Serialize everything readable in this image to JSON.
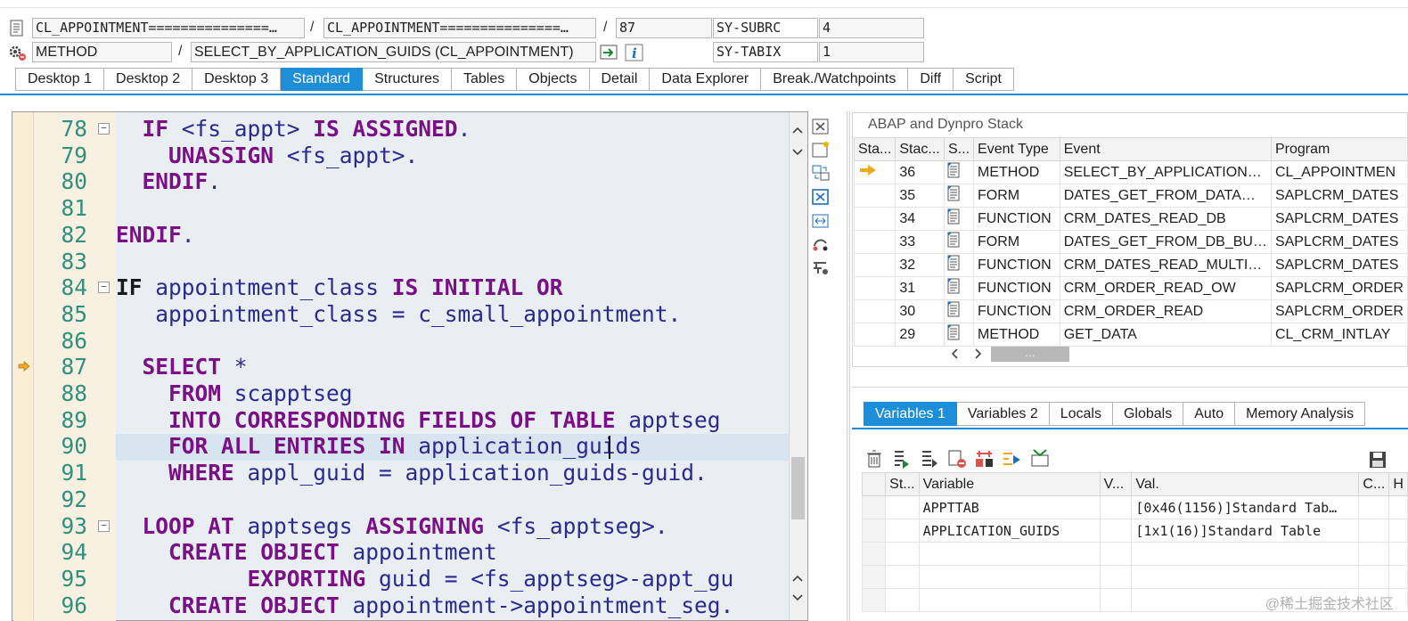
{
  "header": {
    "row1": {
      "program": "CL_APPOINTMENT===============…",
      "include": "CL_APPOINTMENT===============…",
      "line": "87",
      "sy_label": "SY-SUBRC",
      "sy_value": "4"
    },
    "row2": {
      "event_type": "METHOD",
      "event": "SELECT_BY_APPLICATION_GUIDS (CL_APPOINTMENT)",
      "sy_label": "SY-TABIX",
      "sy_value": "1"
    },
    "separator": "/"
  },
  "tabs": [
    "Desktop 1",
    "Desktop 2",
    "Desktop 3",
    "Standard",
    "Structures",
    "Tables",
    "Objects",
    "Detail",
    "Data Explorer",
    "Break./Watchpoints",
    "Diff",
    "Script"
  ],
  "active_tab": "Standard",
  "editor": {
    "lines": [
      {
        "n": "78",
        "fold": true,
        "indent": "  ",
        "tokens": [
          [
            "kw",
            "IF "
          ],
          [
            "t",
            "<fs_appt> "
          ],
          [
            "kw",
            "IS ASSIGNED"
          ],
          [
            "t",
            "."
          ]
        ]
      },
      {
        "n": "79",
        "fold": false,
        "indent": "    ",
        "tokens": [
          [
            "kw",
            "UNASSIGN "
          ],
          [
            "t",
            "<fs_appt>."
          ]
        ]
      },
      {
        "n": "80",
        "fold": false,
        "indent": "  ",
        "tokens": [
          [
            "kw",
            "ENDIF"
          ],
          [
            "t",
            "."
          ]
        ]
      },
      {
        "n": "81",
        "fold": false,
        "indent": "",
        "tokens": []
      },
      {
        "n": "82",
        "fold": false,
        "indent": "",
        "tokens": [
          [
            "kw",
            "ENDIF"
          ],
          [
            "t",
            "."
          ]
        ]
      },
      {
        "n": "83",
        "fold": false,
        "indent": "",
        "tokens": []
      },
      {
        "n": "84",
        "fold": true,
        "indent": "",
        "tokens": [
          [
            "kwb",
            "IF "
          ],
          [
            "t",
            "appointment_class "
          ],
          [
            "kw",
            "IS INITIAL OR"
          ]
        ]
      },
      {
        "n": "85",
        "fold": false,
        "indent": "   ",
        "tokens": [
          [
            "t",
            "appointment_class = c_small_appointment."
          ]
        ]
      },
      {
        "n": "86",
        "fold": false,
        "indent": "",
        "tokens": []
      },
      {
        "n": "87",
        "fold": false,
        "indent": "  ",
        "tokens": [
          [
            "kw",
            "SELECT "
          ],
          [
            "t",
            "*"
          ]
        ]
      },
      {
        "n": "88",
        "fold": false,
        "indent": "    ",
        "tokens": [
          [
            "kw",
            "FROM "
          ],
          [
            "t",
            "scapptseg"
          ]
        ]
      },
      {
        "n": "89",
        "fold": false,
        "indent": "    ",
        "tokens": [
          [
            "kw",
            "INTO CORRESPONDING FIELDS OF TABLE "
          ],
          [
            "t",
            "apptseg"
          ]
        ]
      },
      {
        "n": "90",
        "fold": false,
        "indent": "    ",
        "tokens": [
          [
            "kw",
            "FOR ALL ENTRIES IN "
          ],
          [
            "t",
            "application_guids"
          ]
        ]
      },
      {
        "n": "91",
        "fold": false,
        "indent": "    ",
        "tokens": [
          [
            "kw",
            "WHERE "
          ],
          [
            "t",
            "appl_guid = application_guids-guid."
          ]
        ]
      },
      {
        "n": "92",
        "fold": false,
        "indent": "",
        "tokens": []
      },
      {
        "n": "93",
        "fold": true,
        "indent": "  ",
        "tokens": [
          [
            "kw",
            "LOOP AT "
          ],
          [
            "t",
            "apptsegs "
          ],
          [
            "kw",
            "ASSIGNING "
          ],
          [
            "t",
            "<fs_apptseg>."
          ]
        ]
      },
      {
        "n": "94",
        "fold": false,
        "indent": "    ",
        "tokens": [
          [
            "kw",
            "CREATE OBJECT "
          ],
          [
            "t",
            "appointment"
          ]
        ]
      },
      {
        "n": "95",
        "fold": false,
        "indent": "          ",
        "tokens": [
          [
            "kw",
            "EXPORTING "
          ],
          [
            "t",
            "guid = <fs_apptseg>-appt_gu"
          ]
        ]
      },
      {
        "n": "96",
        "fold": false,
        "indent": "    ",
        "tokens": [
          [
            "kw",
            "CREATE OBJECT "
          ],
          [
            "t",
            "appointment->appointment_seg."
          ]
        ]
      }
    ],
    "current_line": "87",
    "highlight_line": "90"
  },
  "stack": {
    "title": "ABAP and Dynpro Stack",
    "columns": [
      "Sta...",
      "Stac...",
      "S...",
      "Event Type",
      "Event",
      "Program"
    ],
    "rows": [
      {
        "current": true,
        "depth": "36",
        "type": "METHOD",
        "event": "SELECT_BY_APPLICATION…",
        "program": "CL_APPOINTMEN"
      },
      {
        "current": false,
        "depth": "35",
        "type": "FORM",
        "event": "DATES_GET_FROM_DATA…",
        "program": "SAPLCRM_DATES"
      },
      {
        "current": false,
        "depth": "34",
        "type": "FUNCTION",
        "event": "CRM_DATES_READ_DB",
        "program": "SAPLCRM_DATES"
      },
      {
        "current": false,
        "depth": "33",
        "type": "FORM",
        "event": "DATES_GET_FROM_DB_BU…",
        "program": "SAPLCRM_DATES"
      },
      {
        "current": false,
        "depth": "32",
        "type": "FUNCTION",
        "event": "CRM_DATES_READ_MULTI…",
        "program": "SAPLCRM_DATES"
      },
      {
        "current": false,
        "depth": "31",
        "type": "FUNCTION",
        "event": "CRM_ORDER_READ_OW",
        "program": "SAPLCRM_ORDER"
      },
      {
        "current": false,
        "depth": "30",
        "type": "FUNCTION",
        "event": "CRM_ORDER_READ",
        "program": "SAPLCRM_ORDER"
      },
      {
        "current": false,
        "depth": "29",
        "type": "METHOD",
        "event": "GET_DATA",
        "program": "CL_CRM_INTLAY"
      }
    ]
  },
  "variables": {
    "tabs": [
      "Variables 1",
      "Variables 2",
      "Locals",
      "Globals",
      "Auto",
      "Memory Analysis"
    ],
    "active_tab": "Variables 1",
    "columns": [
      "St...",
      "Variable",
      "V...",
      "Val.",
      "C...",
      "H"
    ],
    "rows": [
      {
        "variable": "APPTTAB",
        "value": "[0x46(1156)]Standard Tab…"
      },
      {
        "variable": "APPLICATION_GUIDS",
        "value": "[1x1(16)]Standard Table"
      },
      {
        "variable": "",
        "value": ""
      },
      {
        "variable": "",
        "value": ""
      },
      {
        "variable": "",
        "value": ""
      }
    ]
  },
  "scroll_thumb": "…",
  "watermark": "@稀土掘金技术社区",
  "colors": {
    "accent": "#1f8ed8",
    "keyword": "#7a0f86",
    "identifier": "#2a2a8f",
    "line_number": "#2f8f80",
    "current_arrow": "#f0a81c"
  }
}
